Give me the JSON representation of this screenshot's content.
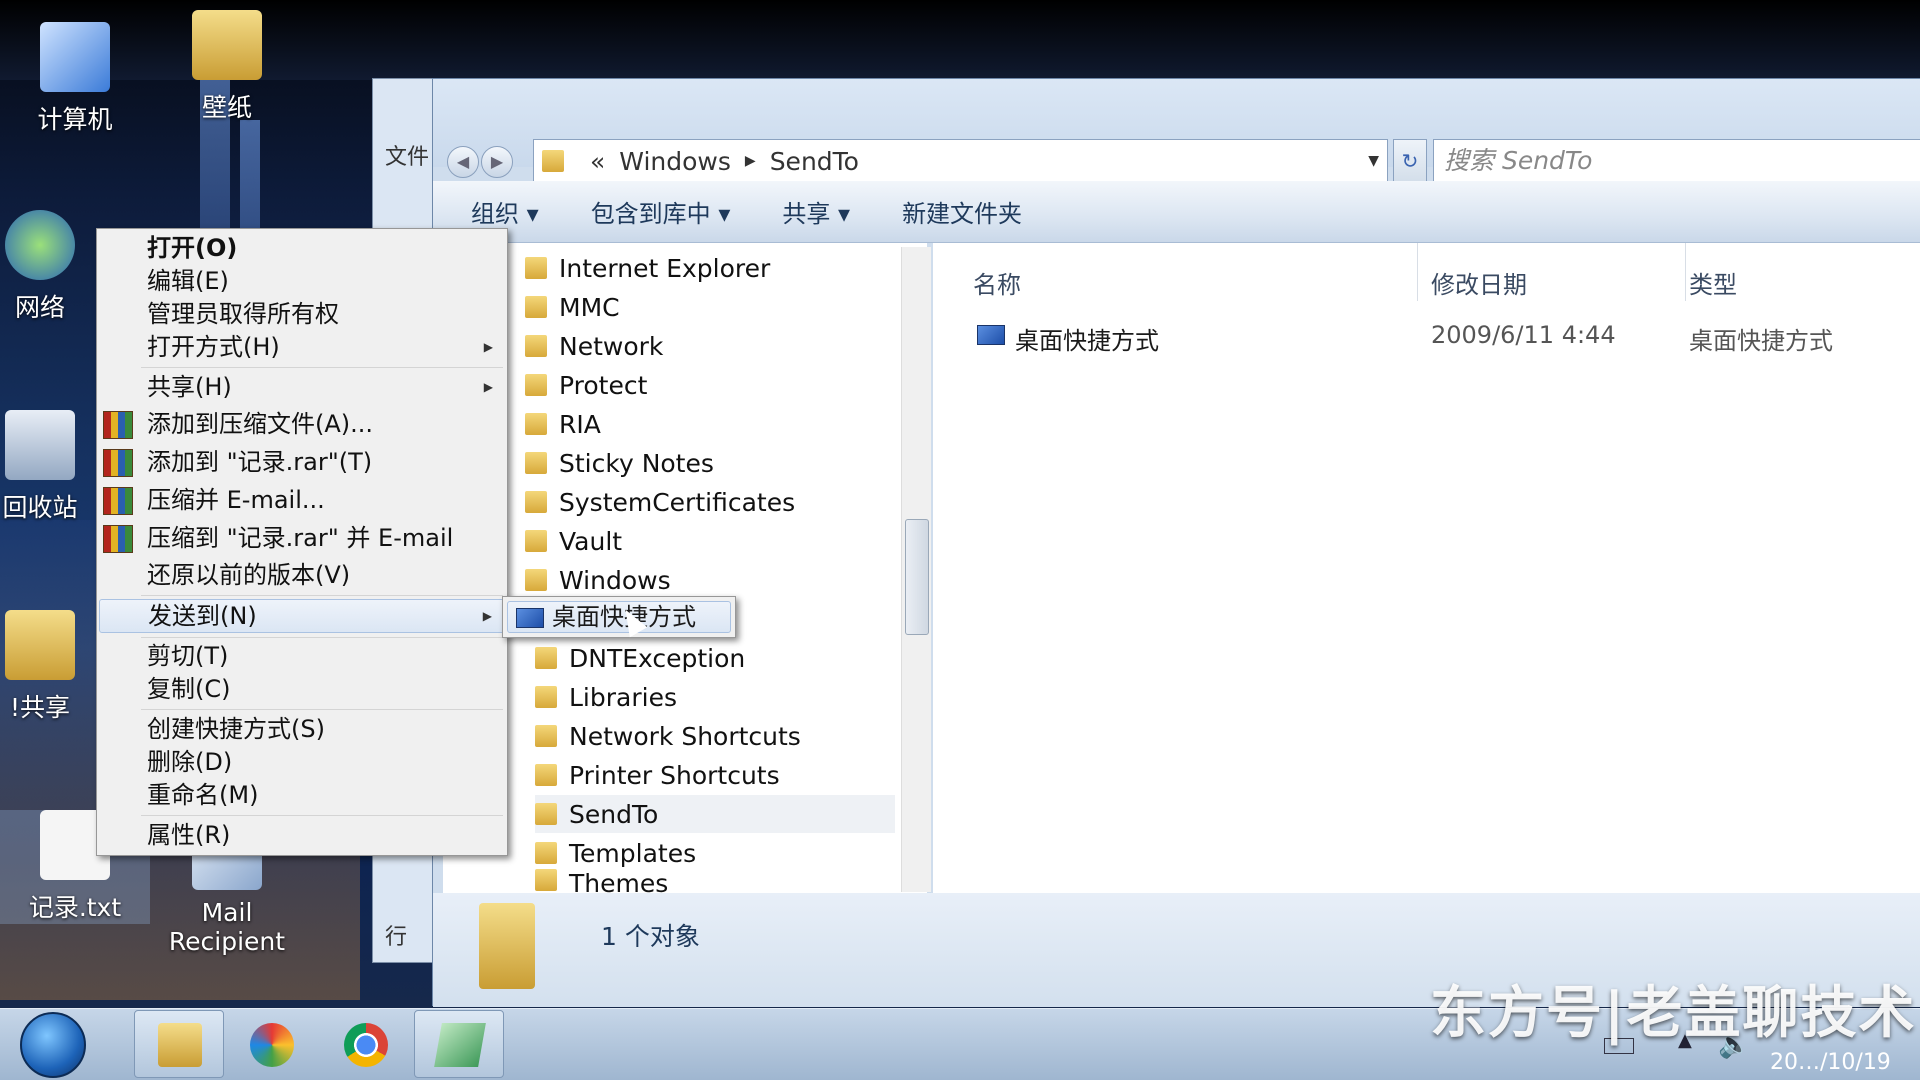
{
  "desktop": {
    "icons": [
      {
        "label": "计算机",
        "name": "computer-icon"
      },
      {
        "label": "壁纸",
        "name": "wallpaper-folder-icon"
      },
      {
        "label": "网络",
        "name": "network-icon"
      },
      {
        "label": "回收站",
        "name": "recycle-bin-icon"
      },
      {
        "label": "!共享",
        "name": "share-folder-icon"
      },
      {
        "label": "记录.txt",
        "name": "text-file-icon"
      },
      {
        "label": "Mail Recipient",
        "name": "mail-recipient-icon"
      }
    ]
  },
  "explorer": {
    "breadcrumb": [
      "«",
      "Windows",
      "SendTo"
    ],
    "search_placeholder": "搜索 SendTo",
    "toolbar": [
      "组织 ▾",
      "包含到库中 ▾",
      "共享 ▾",
      "新建文件夹"
    ],
    "tree": [
      "Internet Explorer",
      "MMC",
      "Network",
      "Protect",
      "RIA",
      "Sticky Notes",
      "SystemCertificates",
      "Vault",
      "Windows"
    ],
    "tree2": [
      "DNTException",
      "Libraries",
      "Network Shortcuts",
      "Printer Shortcuts",
      "SendTo",
      "Templates",
      "Themes"
    ],
    "columns": [
      "名称",
      "修改日期",
      "类型"
    ],
    "files": [
      {
        "name": "桌面快捷方式",
        "date": "2009/6/11 4:44",
        "type": "桌面快捷方式"
      }
    ],
    "status": "1 个对象",
    "bgwin_labels": [
      "文件",
      "行"
    ]
  },
  "context_menu": {
    "items": [
      "打开(O)",
      "编辑(E)",
      "管理员取得所有权",
      "打开方式(H)",
      "共享(H)",
      "添加到压缩文件(A)...",
      "添加到 \"记录.rar\"(T)",
      "压缩并 E-mail...",
      "压缩到 \"记录.rar\" 并 E-mail",
      "还原以前的版本(V)",
      "发送到(N)",
      "剪切(T)",
      "复制(C)",
      "创建快捷方式(S)",
      "删除(D)",
      "重命名(M)",
      "属性(R)"
    ],
    "submenu_item": "桌面快捷方式"
  },
  "taskbar": {
    "clock": "20…/10/19"
  },
  "watermark": "东方号|老盖聊技术"
}
